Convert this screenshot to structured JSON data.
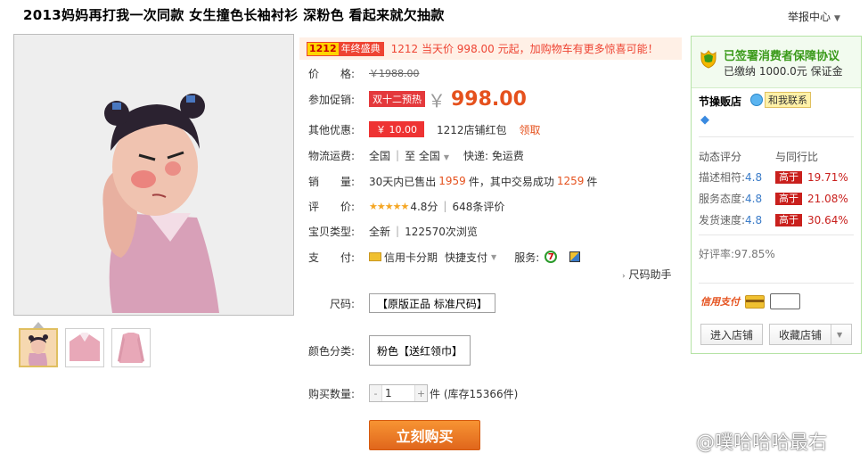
{
  "header": {
    "title": "2013妈妈再打我一次同款 女生撞色长袖衬衫 深粉色 看起来就欠抽款",
    "report_label": "举报中心"
  },
  "promo": {
    "badge_num": "1212",
    "badge_text": "年终盛典",
    "text": "1212 当天价 998.00 元起，加购物车有更多惊喜可能！"
  },
  "product": {
    "price_label": "价　　格:",
    "price_old": "￥1988.00",
    "promo_label": "参加促销:",
    "promo_tag": "双十二预热",
    "currency": "￥",
    "price_now": "998.00",
    "discount_label": "其他优惠:",
    "coupon": "￥ 10.00",
    "coupon_name": "1212店铺红包",
    "coupon_claim": "领取",
    "shipping_label": "物流运费:",
    "ship_from": "全国",
    "ship_to": "至 全国",
    "ship_method": "快递: 免运费",
    "sales_label": "销　　量:",
    "sales_prefix": "30天内已售出",
    "sales_count": "1959",
    "sales_mid": "件，其中交易成功",
    "sales_success": "1259",
    "sales_suffix": "件",
    "rating_label": "评　　价:",
    "stars": "★★★★★",
    "rating_score": "4.8分",
    "rating_count": "648条评价",
    "type_label": "宝贝类型:",
    "type_value": "全新",
    "views": "122570次浏览",
    "pay_label": "支　　付:",
    "pay_installment": "信用卡分期",
    "pay_fast": "快捷支付",
    "service_label": "服务:",
    "size_helper": "尺码助手",
    "size_label": "尺码:",
    "size_value": "【原版正品 标准尺码】",
    "color_label": "颜色分类:",
    "color_value": "粉色【送红领巾】",
    "qty_label": "购买数量:",
    "qty_value": "1",
    "qty_minus": "-",
    "qty_plus": "+",
    "stock": "件 (库存15366件)",
    "buy_label": "立刻购买"
  },
  "sidebar": {
    "protect_title": "已签署消费者保障协议",
    "protect_deposit": "已缴纳 1000.0元 保证金",
    "shop_name": "节操贩店",
    "chat_label": "和我联系",
    "rate_head": "动态评分",
    "compare_head": "与同行比",
    "ratings": [
      {
        "label": "描述相符:",
        "value": "4.8",
        "badge": "高于",
        "pct": "19.71%"
      },
      {
        "label": "服务态度:",
        "value": "4.8",
        "badge": "高于",
        "pct": "21.08%"
      },
      {
        "label": "发货速度:",
        "value": "4.8",
        "badge": "高于",
        "pct": "30.64%"
      }
    ],
    "good_rate": "好评率:97.85%",
    "credit_label": "信用支付",
    "enter_shop": "进入店铺",
    "fav_shop": "收藏店铺"
  },
  "watermark": "@噗哈哈哈最右"
}
